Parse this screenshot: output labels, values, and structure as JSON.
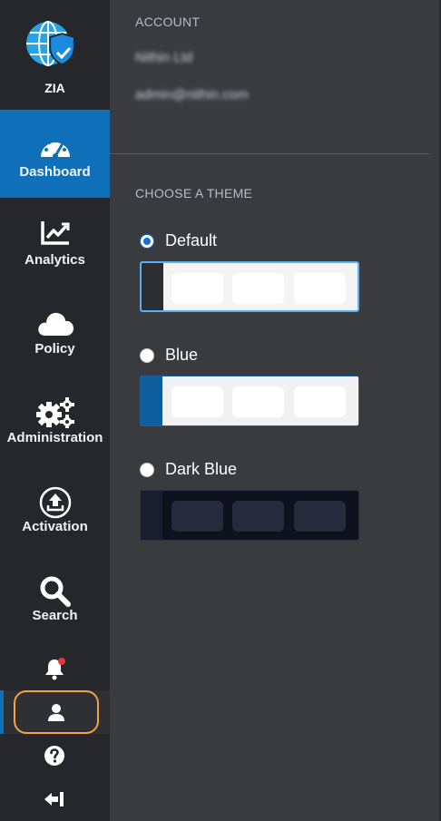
{
  "sidebar": {
    "logo_label": "ZIA",
    "items": [
      {
        "label": "Dashboard",
        "icon": "gauge-icon",
        "active": true
      },
      {
        "label": "Analytics",
        "icon": "chart-icon"
      },
      {
        "label": "Policy",
        "icon": "cloud-icon"
      },
      {
        "label": "Administration",
        "icon": "gears-icon"
      },
      {
        "label": "Activation",
        "icon": "upload-icon"
      },
      {
        "label": "Search",
        "icon": "search-icon"
      }
    ],
    "bottom_icons": [
      "bell-icon",
      "user-icon",
      "help-icon",
      "logout-icon"
    ],
    "accent": "#0f6fb8",
    "highlight_ring": "#f0a347"
  },
  "account": {
    "title": "ACCOUNT",
    "org_name": "Nithin Ltd",
    "email": "admin@nithin.com"
  },
  "theme": {
    "title": "CHOOSE A THEME",
    "options": [
      {
        "label": "Default",
        "selected": true
      },
      {
        "label": "Blue",
        "selected": false
      },
      {
        "label": "Dark Blue",
        "selected": false
      }
    ]
  }
}
